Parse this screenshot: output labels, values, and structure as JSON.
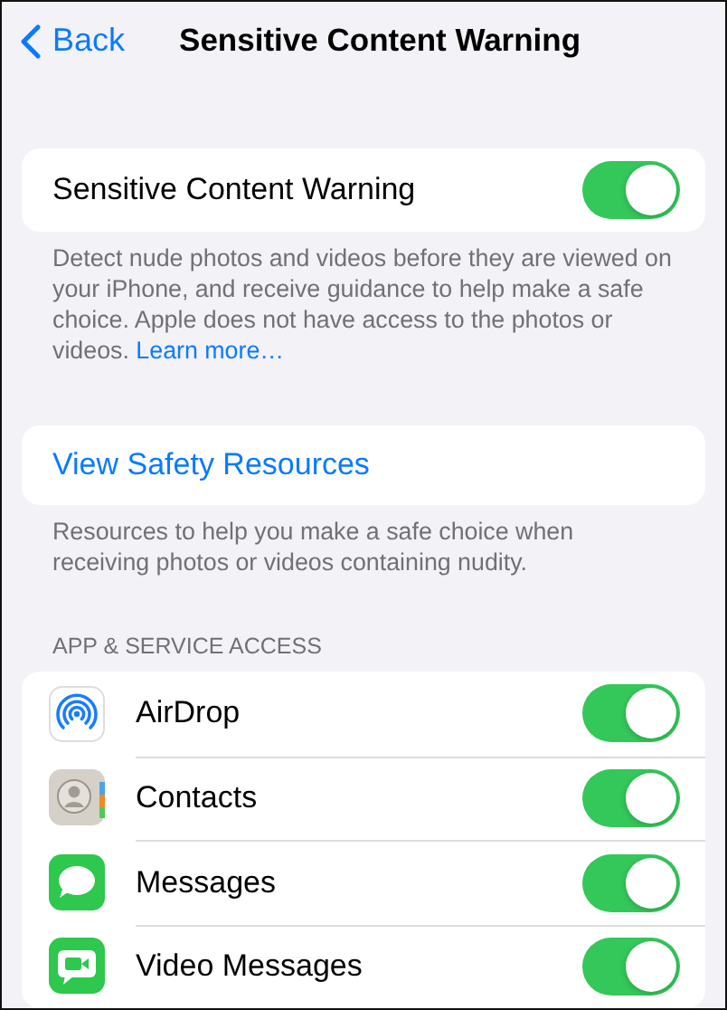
{
  "nav": {
    "back": "Back",
    "title": "Sensitive Content Warning"
  },
  "warning": {
    "label": "Sensitive Content Warning",
    "on": true,
    "description": "Detect nude photos and videos before they are viewed on your iPhone, and receive guidance to help make a safe choice. Apple does not have access to the photos or videos.",
    "link": "Learn more…"
  },
  "resources": {
    "link": "View Safety Resources",
    "description": "Resources to help you make a safe choice when receiving photos or videos containing nudity."
  },
  "access": {
    "header": "APP & SERVICE ACCESS",
    "items": [
      {
        "kind": "airdrop",
        "label": "AirDrop",
        "on": true
      },
      {
        "kind": "contacts",
        "label": "Contacts",
        "on": true
      },
      {
        "kind": "messages",
        "label": "Messages",
        "on": true
      },
      {
        "kind": "video",
        "label": "Video Messages",
        "on": true
      }
    ]
  }
}
